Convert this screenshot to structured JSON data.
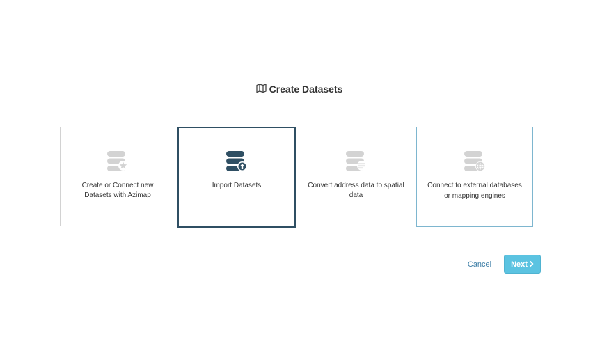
{
  "dialog": {
    "title": "Create Datasets",
    "title_icon": "map-icon",
    "options": [
      {
        "label": "Create or Connect new Datasets with Azimap",
        "icon": "database-star-icon",
        "selected": false
      },
      {
        "label": "Import Datasets",
        "icon": "database-upload-icon",
        "selected": true
      },
      {
        "label": "Convert address data to spatial data",
        "icon": "database-list-icon",
        "selected": false
      },
      {
        "label": "Connect to external databases or mapping engines",
        "icon": "database-globe-icon",
        "selected": false
      }
    ],
    "cancel_label": "Cancel",
    "next_label": "Next",
    "next_icon": "chevron-right-icon"
  },
  "colors": {
    "selected_border": "#2f4f63",
    "hover_border": "#7eb6cf",
    "icon_inactive": "#d3d3d3",
    "icon_active": "#2f4f63",
    "primary_button": "#5bc3e1",
    "link": "#3a7ca5"
  }
}
